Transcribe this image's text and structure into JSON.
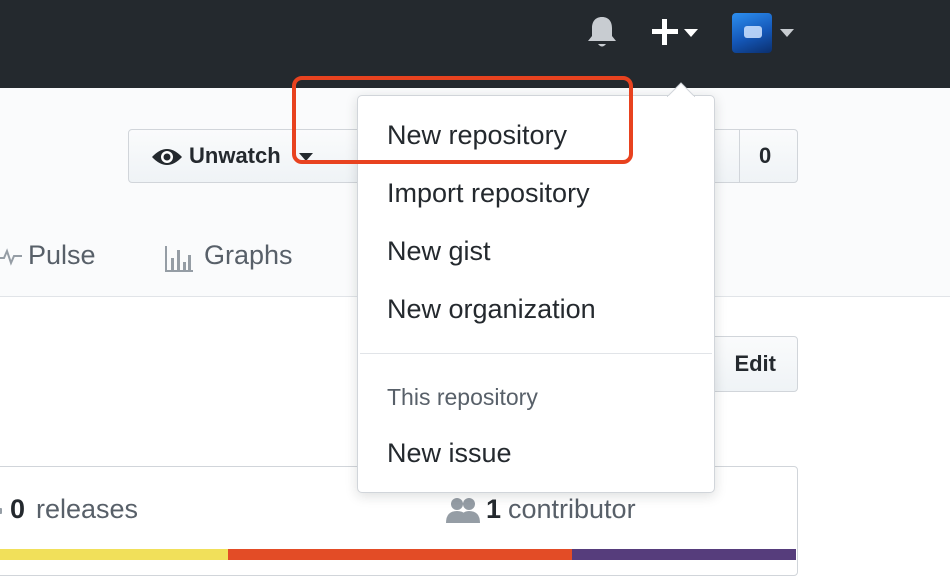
{
  "header": {
    "icons": [
      "bell-icon",
      "plus-icon",
      "chevron-down-icon",
      "avatar",
      "chevron-down-icon"
    ]
  },
  "repo": {
    "unwatch_label": "Unwatch",
    "counter_value": "0",
    "nav": {
      "pulse": "Pulse",
      "graphs": "Graphs"
    },
    "edit_label": "Edit"
  },
  "stats": {
    "releases_count": "0",
    "releases_label": "releases",
    "contributors_count": "1",
    "contributors_label": "contributor",
    "language_colors": [
      "#f1e05a",
      "#e34c26",
      "#563d7c"
    ]
  },
  "menu": {
    "items": [
      {
        "label": "New repository"
      },
      {
        "label": "Import repository"
      },
      {
        "label": "New gist"
      },
      {
        "label": "New organization"
      }
    ],
    "section_header": "This repository",
    "section_items": [
      {
        "label": "New issue"
      }
    ]
  },
  "colors": {
    "header_bg": "#24292e",
    "highlight": "#e8421f"
  }
}
